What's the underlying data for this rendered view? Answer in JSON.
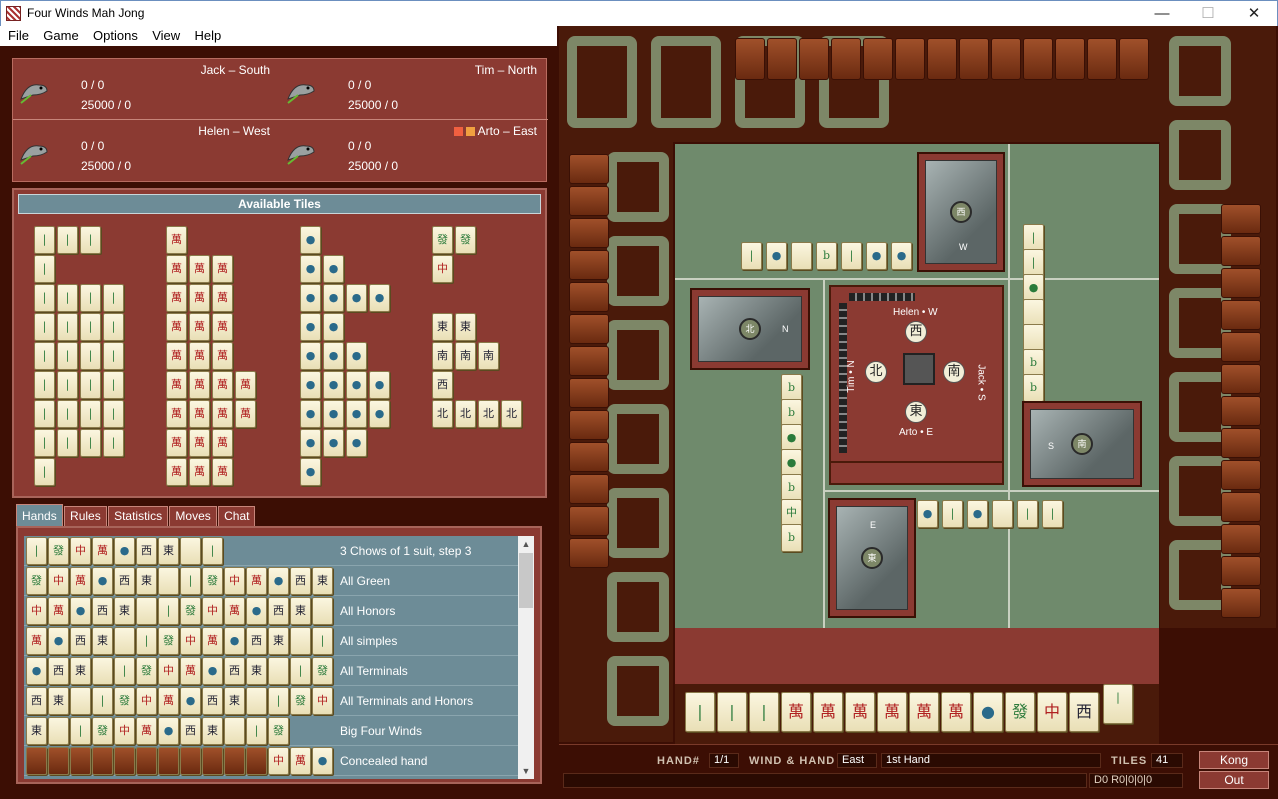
{
  "window": {
    "title": "Four Winds Mah Jong",
    "minimize": "—",
    "maximize": "☐",
    "close": "✕"
  },
  "menu": [
    "File",
    "Game",
    "Options",
    "View",
    "Help"
  ],
  "players": [
    {
      "name": "Jack – South",
      "score": "0 / 0",
      "balance": "25000 / 0"
    },
    {
      "name": "Tim – North",
      "score": "0 / 0",
      "balance": "25000 / 0"
    },
    {
      "name": "Helen – West",
      "score": "0 / 0",
      "balance": "25000 / 0"
    },
    {
      "name": "Arto – East",
      "score": "0 / 0",
      "balance": "25000 / 0"
    }
  ],
  "available": {
    "title": "Available Tiles"
  },
  "tabs": [
    "Hands",
    "Rules",
    "Statistics",
    "Moves",
    "Chat"
  ],
  "hands": [
    "3 Chows of 1 suit, step 3",
    "All Green",
    "All Honors",
    "All simples",
    "All Terminals",
    "All Terminals and Honors",
    "Big Four Winds",
    "Concealed hand"
  ],
  "center": {
    "top": "Helen • W",
    "right": "Jack • S",
    "left": "Tim • N",
    "bottom": "Arto • E",
    "wind_top": "西",
    "wind_right": "南",
    "wind_left": "北",
    "wind_bottom": "東"
  },
  "status": {
    "hand_label": "HAND#",
    "hand_value": "1/1",
    "wind_label": "WIND & HAND",
    "wind_value": "East",
    "hand_name": "1st Hand",
    "tiles_label": "TILES",
    "tiles_value": "41",
    "score_text": "D0 R0|0|0|0"
  },
  "buttons": {
    "kong": "Kong",
    "out": "Out"
  },
  "colors": {
    "felt": "#6f8a6c",
    "panel": "#8b3a32",
    "dark": "#3c0e04",
    "steel": "#6d8c97"
  }
}
